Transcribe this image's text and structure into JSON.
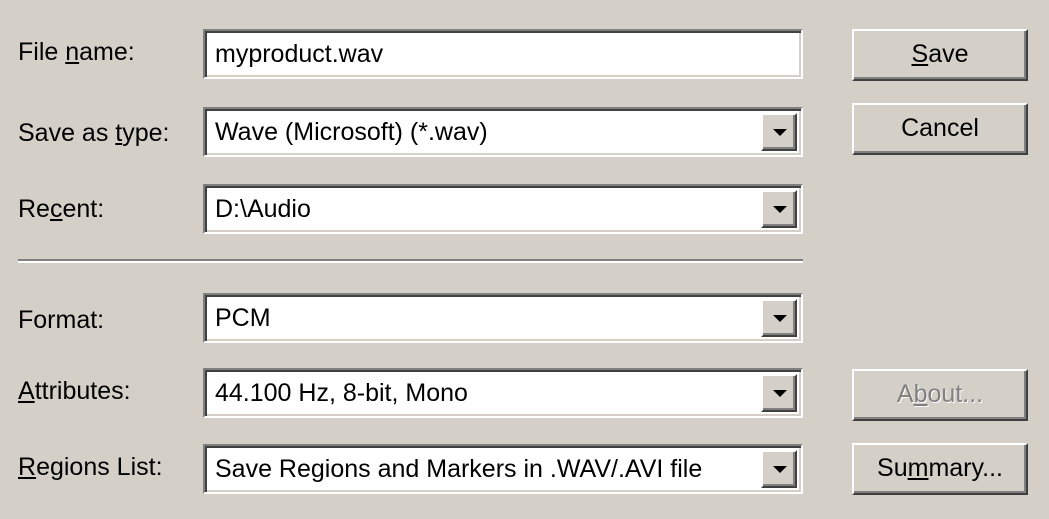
{
  "labels": {
    "file_name": {
      "pre": "File ",
      "acc": "n",
      "post": "ame:"
    },
    "save_as_type": {
      "pre": "Save as ",
      "acc": "t",
      "post": "ype:"
    },
    "recent": {
      "pre": "Re",
      "acc": "c",
      "post": "ent:"
    },
    "format": {
      "pre": "Format:",
      "acc": "",
      "post": ""
    },
    "attributes": {
      "pre": "",
      "acc": "A",
      "post": "ttributes:"
    },
    "regions_list": {
      "pre": "",
      "acc": "R",
      "post": "egions List:"
    }
  },
  "fields": {
    "file_name": "myproduct.wav",
    "save_as_type": "Wave (Microsoft) (*.wav)",
    "recent": "D:\\Audio",
    "format": "PCM",
    "attributes": "44.100 Hz, 8-bit, Mono",
    "regions_list": "Save Regions and Markers in .WAV/.AVI file"
  },
  "buttons": {
    "save": {
      "pre": "",
      "acc": "S",
      "post": "ave"
    },
    "cancel": {
      "pre": "Cancel",
      "acc": "",
      "post": ""
    },
    "about": {
      "pre": "A",
      "acc": "b",
      "post": "out..."
    },
    "summary": {
      "pre": "Su",
      "acc": "m",
      "post": "mary..."
    }
  },
  "icons": {
    "dropdown": "chevron-down-icon"
  }
}
